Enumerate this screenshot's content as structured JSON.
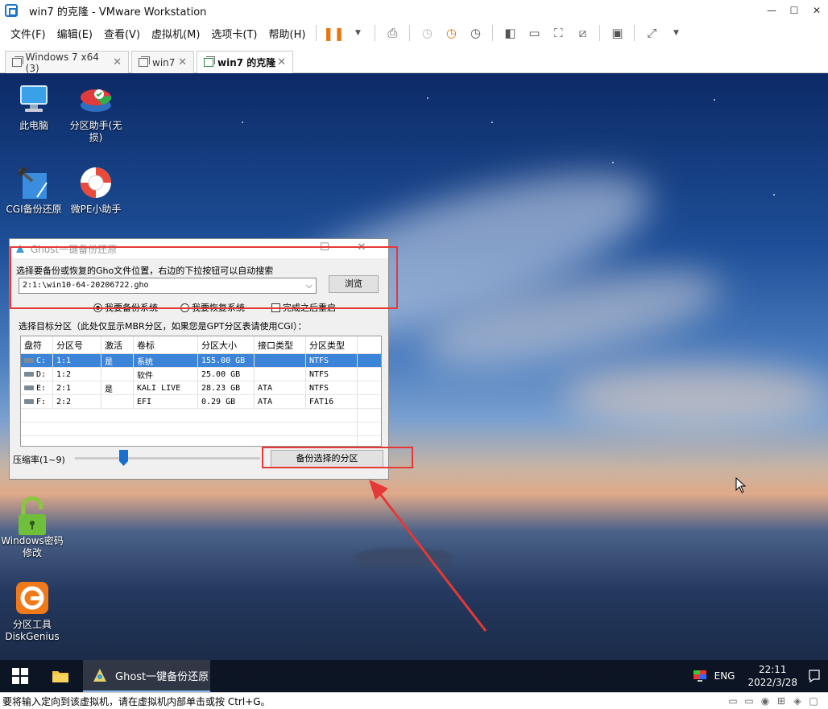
{
  "window": {
    "title": "win7 的克隆 - VMware Workstation"
  },
  "menu": [
    "文件(F)",
    "编辑(E)",
    "查看(V)",
    "虚拟机(M)",
    "选项卡(T)",
    "帮助(H)"
  ],
  "tabs": [
    {
      "label": "Windows 7 x64 (3)"
    },
    {
      "label": "win7"
    },
    {
      "label": "win7 的克隆"
    }
  ],
  "desktop_icons": [
    {
      "label": "此电脑",
      "icon": "computer-icon"
    },
    {
      "label": "分区助手(无损)",
      "icon": "partition-assistant-icon"
    },
    {
      "label": "CGI备份还原",
      "icon": "cgi-backup-icon"
    },
    {
      "label": "微PE小助手",
      "icon": "lifebuoy-icon"
    },
    {
      "label": "Windows密码修改",
      "icon": "lock-icon"
    },
    {
      "label": "分区工具DiskGenius",
      "icon": "diskgenius-icon"
    }
  ],
  "ghost": {
    "title": "Ghost一键备份还原",
    "prompt": "选择要备份或恢复的Gho文件位置，右边的下拉按钮可以自动搜索",
    "path": "2:1:\\win10-64-20206722.gho",
    "browse": "浏览",
    "opt_backup": "我要备份系统",
    "opt_restore": "我要恢复系统",
    "opt_reboot": "完成之后重启",
    "target_label": "选择目标分区（此处仅显示MBR分区，如果您是GPT分区表请使用CGI）：",
    "columns": [
      "盘符",
      "分区号",
      "激活",
      "卷标",
      "分区大小",
      "接口类型",
      "分区类型"
    ],
    "rows": [
      [
        "C:",
        "1:1",
        "是",
        "系统",
        "155.00 GB",
        "",
        "NTFS"
      ],
      [
        "D:",
        "1:2",
        "",
        "软件",
        "25.00 GB",
        "",
        "NTFS"
      ],
      [
        "E:",
        "2:1",
        "是",
        "KALI LIVE",
        "28.23 GB",
        "ATA",
        "NTFS"
      ],
      [
        "F:",
        "2:2",
        "",
        "EFI",
        "0.29 GB",
        "ATA",
        "FAT16"
      ]
    ],
    "compress_label": "压缩率(1~9)",
    "compress_level": 3,
    "backup_button": "备份选择的分区"
  },
  "taskbar": {
    "app_label": "Ghost一键备份还原",
    "lang": "ENG",
    "time": "22:11",
    "date": "2022/3/28"
  },
  "status": "要将输入定向到该虚拟机，请在虚拟机内部单击或按 Ctrl+G。",
  "colors": {
    "accent": "#3b84d8",
    "annotation": "#e53935",
    "pause": "#e8760c"
  }
}
